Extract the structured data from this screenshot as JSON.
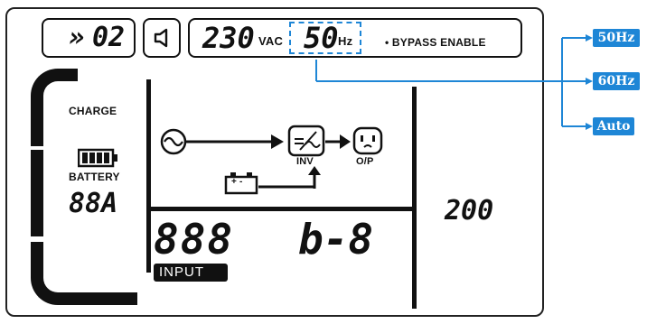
{
  "top_bar": {
    "program_prefix": "»",
    "program_number": "02",
    "voltage": "230",
    "voltage_unit": "VAC",
    "frequency": "50",
    "frequency_unit": "Hz",
    "bypass_text": "• BYPASS ENABLE"
  },
  "left_column": {
    "charge_label": "CHARGE",
    "battery_label": "BATTERY",
    "battery_value": "88A"
  },
  "diagram": {
    "inv_label": "INV",
    "op_label": "O/P",
    "battery_terminals": "+ -"
  },
  "bottom": {
    "input_value": "888",
    "input_label": "INPUT",
    "code_value": "b-8"
  },
  "right_value": "200",
  "callouts": {
    "options": [
      "50Hz",
      "60Hz",
      "Auto"
    ]
  },
  "colors": {
    "callout_blue": "#1e86d6",
    "lcd_black": "#111111"
  }
}
